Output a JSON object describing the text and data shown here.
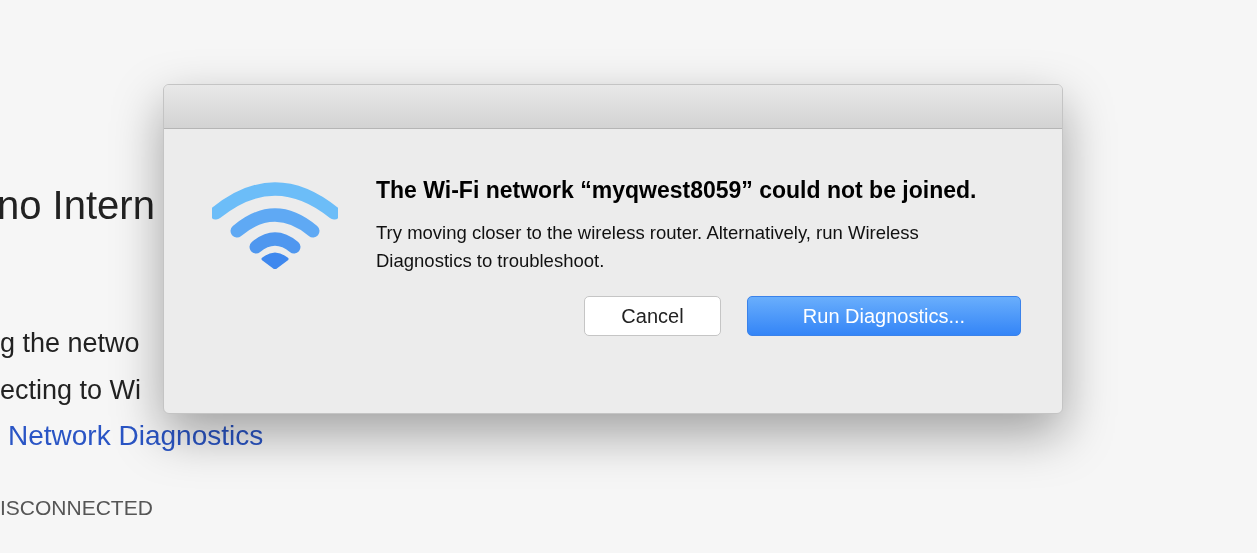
{
  "page": {
    "heading": "no Intern",
    "lines": [
      "g the netwo",
      "ecting to Wi"
    ],
    "link": "Network Diagnostics",
    "status": "ISCONNECTED"
  },
  "dialog": {
    "title": "The Wi-Fi network “myqwest8059” could not be joined.",
    "message": "Try moving closer to the wireless router. Alternatively, run Wireless Diagnostics to troubleshoot.",
    "buttons": [
      {
        "label": "Cancel",
        "kind": "secondary"
      },
      {
        "label": "Run Diagnostics...",
        "kind": "primary"
      }
    ]
  }
}
